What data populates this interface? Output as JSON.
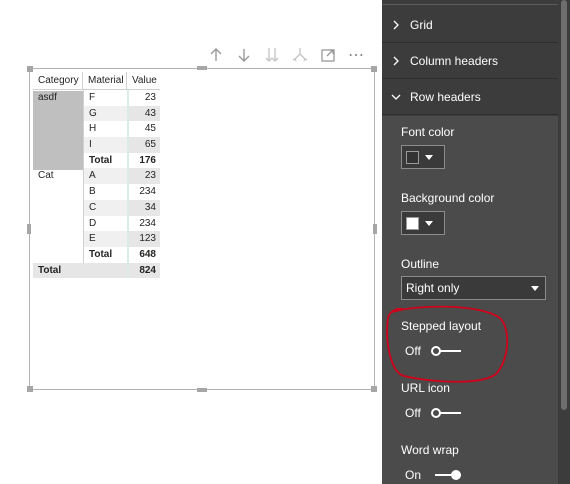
{
  "toolbar": {
    "icons": [
      "arrow-up-icon",
      "arrow-down-icon",
      "double-arrow-down-icon",
      "expand-hierarchy-icon",
      "focus-mode-icon",
      "more-options-icon"
    ],
    "more_label": "⋯"
  },
  "matrix": {
    "headers": {
      "category": "Category",
      "material": "Material",
      "value": "Value"
    },
    "groups": [
      {
        "category": "asdf",
        "rows": [
          {
            "material": "F",
            "value": "23"
          },
          {
            "material": "G",
            "value": "43"
          },
          {
            "material": "H",
            "value": "45"
          },
          {
            "material": "I",
            "value": "65"
          }
        ],
        "total_label": "Total",
        "total_value": "176"
      },
      {
        "category": "Cat",
        "rows": [
          {
            "material": "A",
            "value": "23"
          },
          {
            "material": "B",
            "value": "234"
          },
          {
            "material": "C",
            "value": "34"
          },
          {
            "material": "D",
            "value": "234"
          },
          {
            "material": "E",
            "value": "123"
          }
        ],
        "total_label": "Total",
        "total_value": "648"
      }
    ],
    "grand_total_label": "Total",
    "grand_total_value": "824"
  },
  "format_pane": {
    "sections": {
      "grid": "Grid",
      "column_headers": "Column headers",
      "row_headers": "Row headers"
    },
    "font_color_label": "Font color",
    "font_color_value": "#333333",
    "background_color_label": "Background color",
    "background_color_value": "#ffffff",
    "outline_label": "Outline",
    "outline_value": "Right only",
    "stepped_layout_label": "Stepped layout",
    "stepped_layout_state": "Off",
    "url_icon_label": "URL icon",
    "url_icon_state": "Off",
    "word_wrap_label": "Word wrap",
    "word_wrap_state": "On"
  },
  "colors": {
    "pane_bg": "#3c3c3c",
    "pane_expanded_bg": "#4b4b4b",
    "annotation": "#d0021b",
    "stripe": "#e6e6e6"
  }
}
